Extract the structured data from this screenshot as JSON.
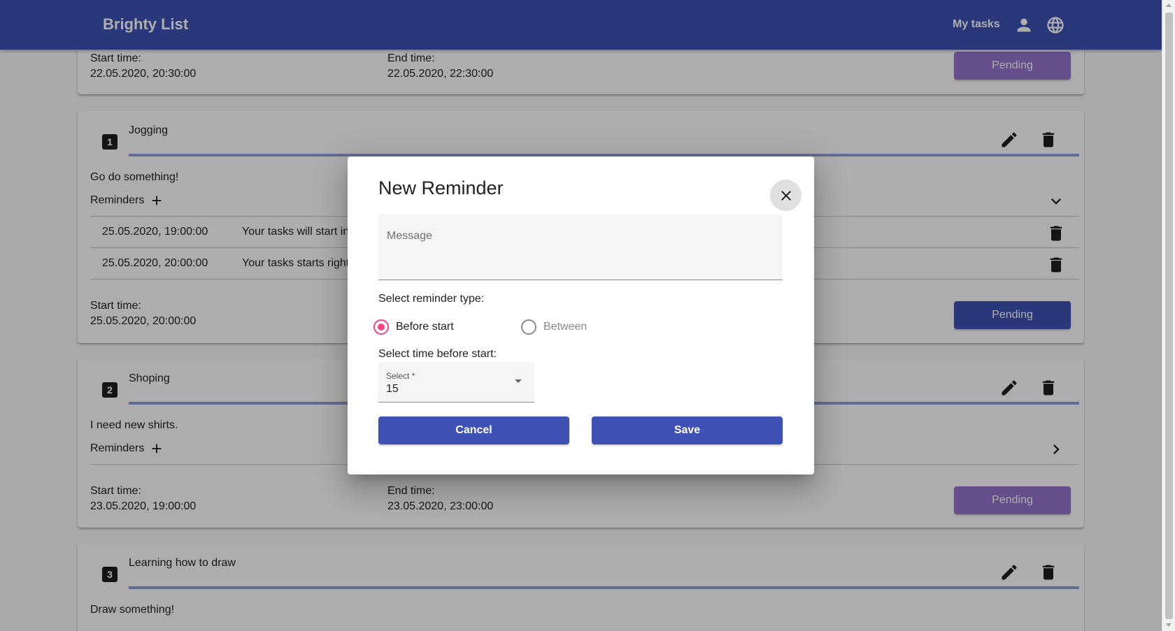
{
  "header": {
    "brand": "Brighty List",
    "nav_my_tasks": "My tasks",
    "icons": [
      "account-icon",
      "language-globe-icon"
    ]
  },
  "tasks": [
    {
      "start_label": "Start time:",
      "start_value": "22.05.2020, 20:30:00",
      "end_label": "End time:",
      "end_value": "22.05.2020, 22:30:00",
      "status": "Pending"
    },
    {
      "number": "1",
      "title": "Jogging",
      "description": "Go do something!",
      "reminders_label": "Reminders",
      "reminders": [
        {
          "date": "25.05.2020, 19:00:00",
          "message": "Your tasks will start in"
        },
        {
          "date": "25.05.2020, 20:00:00",
          "message": "Your tasks starts right"
        }
      ],
      "start_label": "Start time:",
      "start_value": "25.05.2020, 20:00:00",
      "status": "Pending"
    },
    {
      "number": "2",
      "title": "Shoping",
      "description": "I need new shirts.",
      "reminders_label": "Reminders",
      "start_label": "Start time:",
      "start_value": "23.05.2020, 19:00:00",
      "end_label": "End time:",
      "end_value": "23.05.2020, 23:00:00",
      "status": "Pending"
    },
    {
      "number": "3",
      "title": "Learning how to draw",
      "description": "Draw something!"
    }
  ],
  "dialog": {
    "title": "New Reminder",
    "message_placeholder": "Message",
    "type_label": "Select reminder type:",
    "type_options": [
      "Before start",
      "Between"
    ],
    "type_selected": "Before start",
    "time_label": "Select time before start:",
    "select_label": "Select *",
    "select_value": "15",
    "cancel_label": "Cancel",
    "save_label": "Save"
  },
  "colors": {
    "primary": "#3f51b5",
    "accent": "#ff4081",
    "status_pending_light": "#9575cd",
    "status_pending_dark": "#3f51b5"
  }
}
